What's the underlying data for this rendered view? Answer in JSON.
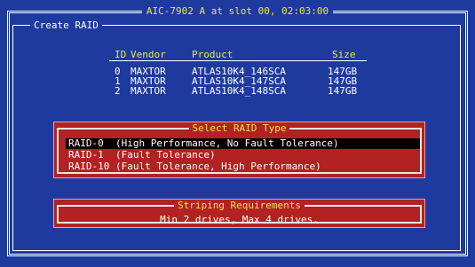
{
  "title": "AIC-7902 A at slot 00, 02:03:00",
  "panel_title": "Create RAID",
  "drives": {
    "headers": {
      "id": "ID",
      "vendor": "Vendor",
      "product": "Product",
      "size": "Size"
    },
    "rows": [
      {
        "id": "0",
        "vendor": "MAXTOR",
        "product": "ATLAS10K4_146SCA",
        "size": "147GB"
      },
      {
        "id": "1",
        "vendor": "MAXTOR",
        "product": "ATLAS10K4_147SCA",
        "size": "147GB"
      },
      {
        "id": "2",
        "vendor": "MAXTOR",
        "product": "ATLAS10K4_148SCA",
        "size": "147GB"
      }
    ]
  },
  "raid_select": {
    "title": "Select RAID Type",
    "options": [
      {
        "label": "RAID-0  (High Performance, No Fault Tolerance)",
        "selected": true
      },
      {
        "label": "RAID-1  (Fault Tolerance)",
        "selected": false
      },
      {
        "label": "RAID-10 (Fault Tolerance, High Performance)",
        "selected": false
      }
    ]
  },
  "striping": {
    "title": "Striping Requirements",
    "text": "Min 2 drives, Max 4 drives."
  },
  "colors": {
    "background": "#1e3a9e",
    "highlight_text": "#e8e84a",
    "dialog_red": "#b22222",
    "selection": "#000000"
  }
}
